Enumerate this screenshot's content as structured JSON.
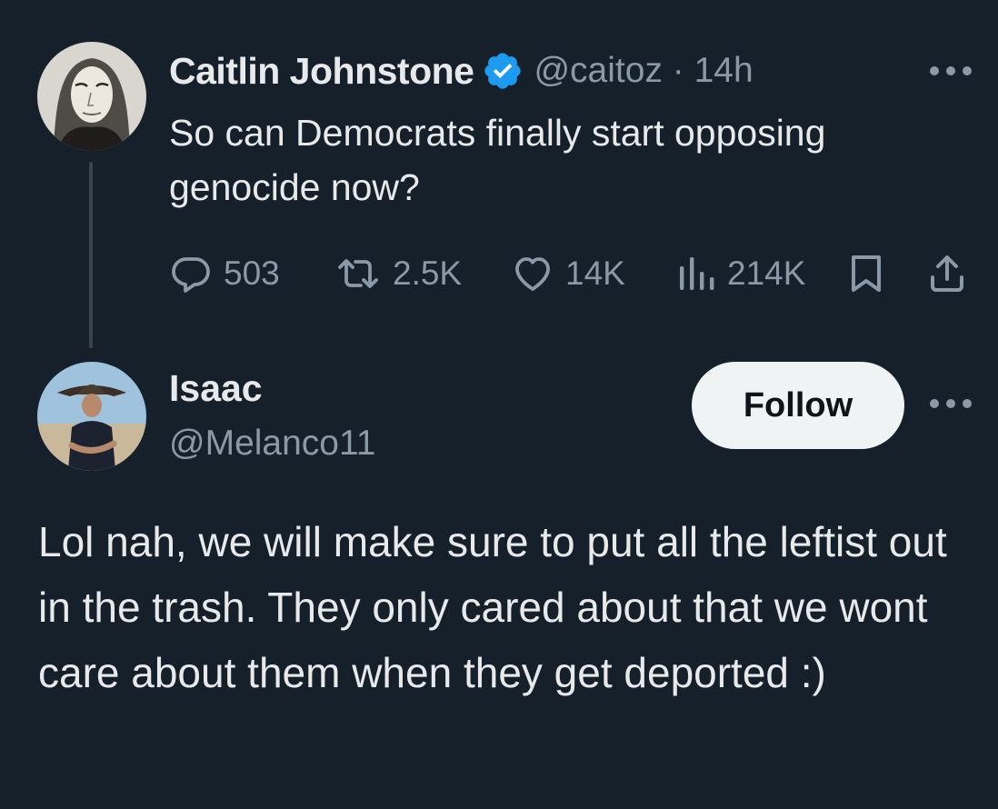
{
  "original_tweet": {
    "display_name": "Caitlin Johnstone",
    "verified_icon": "verified-badge-icon",
    "handle_time": "@caitoz · 14h",
    "text": "So can Democrats finally start opposing genocide now?",
    "stats": {
      "replies": "503",
      "retweets": "2.5K",
      "likes": "14K",
      "views": "214K"
    }
  },
  "reply_tweet": {
    "display_name": "Isaac",
    "handle": "@Melanco11",
    "follow_label": "Follow",
    "text": "Lol nah, we will make sure to put all the leftist out in the trash. They only cared about that we wont care about them when they get deported :)"
  },
  "colors": {
    "background": "#15202b",
    "primary_text": "#e7e9ea",
    "secondary_text": "#8b98a5",
    "verified_blue": "#1d9bf0",
    "follow_button_bg": "#eff3f4",
    "follow_button_text": "#0f1419",
    "thread_line": "#38444d"
  },
  "icons": [
    "more-icon",
    "reply-icon",
    "retweet-icon",
    "like-icon",
    "views-icon",
    "bookmark-icon",
    "share-icon"
  ]
}
